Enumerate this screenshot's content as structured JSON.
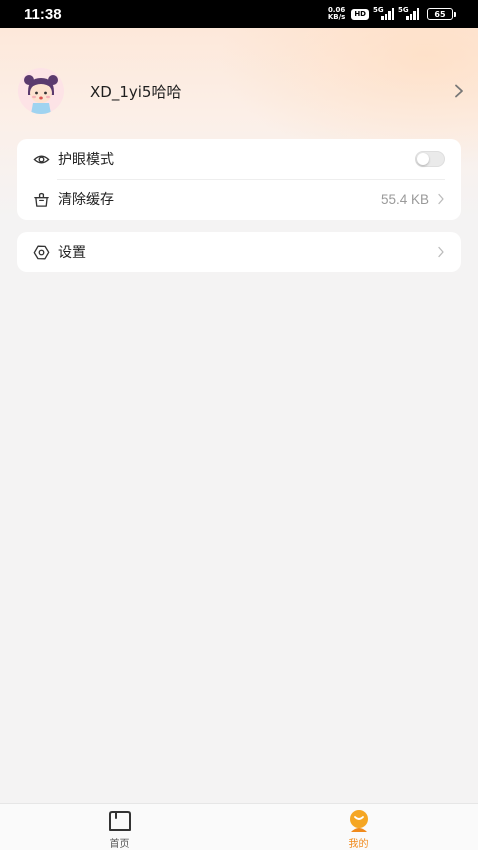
{
  "status_bar": {
    "time": "11:38",
    "net_speed_value": "0.06",
    "net_speed_unit": "KB/s",
    "hd_label": "HD",
    "sim1_label": "5G",
    "sim2_label": "5G",
    "battery": "65"
  },
  "profile": {
    "username": "XD_1yi5哈哈",
    "avatar_icon": "girl-avatar-icon",
    "arrow_icon": "chevron-right-icon"
  },
  "settings_card": {
    "eye_care": {
      "label": "护眼模式",
      "icon": "eye-icon",
      "enabled": false
    },
    "clear_cache": {
      "label": "清除缓存",
      "icon": "broom-icon",
      "value": "55.4 KB"
    }
  },
  "settings_link": {
    "label": "设置",
    "icon": "gear-eye-icon"
  },
  "tab_bar": {
    "tabs": [
      {
        "label": "首页",
        "icon": "home-icon",
        "active": false
      },
      {
        "label": "我的",
        "icon": "mine-icon",
        "active": true
      }
    ]
  },
  "colors": {
    "accent": "#f08a1c",
    "background": "#f4f3f3",
    "header_gradient_top": "#fde8da"
  }
}
